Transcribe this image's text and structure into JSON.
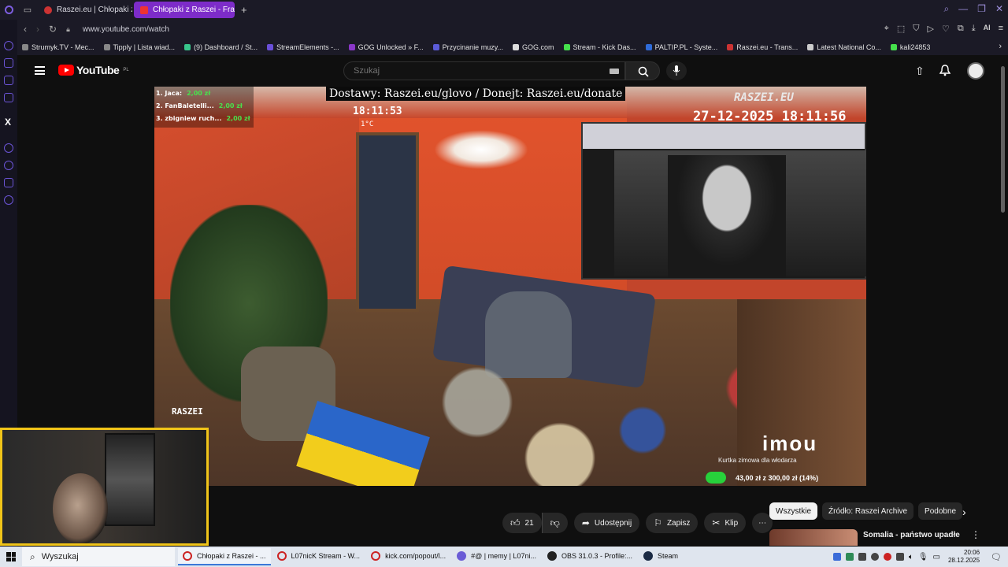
{
  "browser": {
    "tabs": [
      {
        "label": "Raszei.eu | Chłopaki z",
        "active": false
      },
      {
        "label": "Chłopaki z Raszei - Fra",
        "active": true
      }
    ],
    "new_tab": "+",
    "url": "www.youtube.com/watch",
    "ai_label": "AI",
    "bookmarks": [
      "Strumyk.TV - Mec...",
      "Tipply | Lista wiad...",
      "(9) Dashboard / St...",
      "StreamElements -...",
      "GOG Unlocked » F...",
      "Przycinanie muzy...",
      "GOG.com",
      "Stream - Kick Das...",
      "PALTIP.PL - Syste...",
      "Raszei.eu - Trans...",
      "Latest National Co...",
      "kali24853"
    ]
  },
  "youtube": {
    "logo_text": "YouTube",
    "logo_region": "PL",
    "search_placeholder": "Szukaj"
  },
  "video_overlay": {
    "banner": "Dostawy: Raszei.eu/glovo / Donejt: Raszei.eu/donate",
    "time_small": "18:11:53",
    "temperature": "1°C",
    "brand": "RASZEI.EU",
    "datetime": "27-12-2025 18:11:56",
    "raszei_small": "RASZEI",
    "camera_brand": "imou",
    "goal_title": "Kurtka zimowa dla włodarza",
    "goal_progress": "43,00 zł z 300,00 zł (14%)",
    "goal_fraction": 0.14,
    "donations": [
      {
        "name": "1. Jaca:",
        "amount": "2,00 zł"
      },
      {
        "name": "2. FanBaletelli...",
        "amount": "2,00 zł"
      },
      {
        "name": "3. zbigniew ruch...",
        "amount": "2,00 zł"
      }
    ]
  },
  "actions": {
    "like_count": "21",
    "share": "Udostępnij",
    "save": "Zapisz",
    "clip": "Klip",
    "more": "⋯"
  },
  "chips": [
    "Wszystkie",
    "Źródło: Raszei Archive",
    "Podobne"
  ],
  "recommended": {
    "title": "Somalia - państwo upadłe"
  },
  "taskbar": {
    "search": "Wyszukaj",
    "items": [
      {
        "label": "Chłopaki z Raszei - ...",
        "icon": "opera-icon",
        "active": true
      },
      {
        "label": "L07nicK Stream - W...",
        "icon": "opera-icon",
        "active": false
      },
      {
        "label": "kick.com/popout/l...",
        "icon": "opera-icon",
        "active": false
      },
      {
        "label": "#@ | memy | L07ni...",
        "icon": "discord-icon",
        "active": false
      },
      {
        "label": "OBS 31.0.3 - Profile:...",
        "icon": "obs-icon",
        "active": false
      },
      {
        "label": "Steam",
        "icon": "steam-icon",
        "active": false
      }
    ],
    "time": "20:06",
    "date": "28.12.2025"
  },
  "colors": {
    "accent_tab": "#7d2cc9",
    "yt_red": "#ff0000",
    "webcam_border": "#f0c419",
    "goal_green": "#27d13b"
  }
}
